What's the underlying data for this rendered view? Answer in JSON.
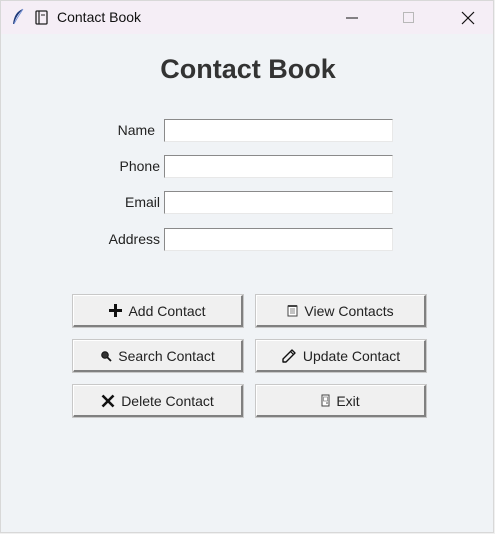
{
  "window": {
    "title": "Contact Book"
  },
  "app": {
    "heading": "Contact Book",
    "fields": [
      {
        "label": "Name",
        "value": ""
      },
      {
        "label": "Phone",
        "value": ""
      },
      {
        "label": "Email",
        "value": ""
      },
      {
        "label": "Address",
        "value": ""
      }
    ],
    "buttons": {
      "add": {
        "label": "Add Contact",
        "icon": "plus-icon"
      },
      "view": {
        "label": "View Contacts",
        "icon": "notepad-icon"
      },
      "search": {
        "label": "Search Contact",
        "icon": "magnifier-icon"
      },
      "update": {
        "label": "Update Contact",
        "icon": "pencil-icon"
      },
      "delete": {
        "label": "Delete Contact",
        "icon": "x-icon"
      },
      "exit": {
        "label": "Exit",
        "icon": "door-icon"
      }
    }
  },
  "colors": {
    "background": "#f0f3f6",
    "titlebar": "#f5eef6",
    "heading_text": "#333333"
  }
}
